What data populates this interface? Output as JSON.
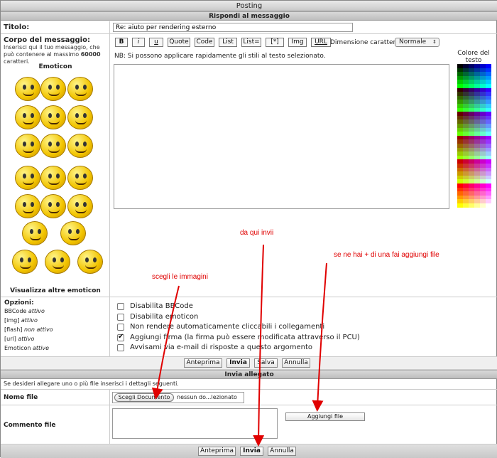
{
  "title": "Posting",
  "reply_section": "Rispondi al messaggio",
  "subject": {
    "label": "Titolo:",
    "value": "Re: aiuto per rendering esterno"
  },
  "body": {
    "label": "Corpo del messaggio:",
    "hint_pre": "Inserisci qui il tuo messaggio, che può contenere al massimo ",
    "hint_num": "60000",
    "hint_post": " caratteri."
  },
  "emoticon_title": "Emoticon",
  "more_emoticons": "Visualizza altre emoticon",
  "toolbar": {
    "buttons": [
      "B",
      "i",
      "u",
      "Quote",
      "Code",
      "List",
      "List=",
      "[*]",
      "Img",
      "URL"
    ],
    "font_size_label": "Dimensione carattere:",
    "font_size_value": "Normale"
  },
  "note": "NB: Si possono applicare rapidamente gli stili al testo selezionato.",
  "color_label": "Colore del testo",
  "options": {
    "label": "Opzioni:",
    "status": [
      {
        "name": "BBCode",
        "state": "attivo"
      },
      {
        "name": "[img]",
        "state": "attivo"
      },
      {
        "name": "[flash]",
        "state": "non attivo"
      },
      {
        "name": "[url]",
        "state": "attivo"
      },
      {
        "name": "Emoticon",
        "state": "attive"
      }
    ],
    "checkboxes": [
      {
        "label": "Disabilita BBCode",
        "checked": false
      },
      {
        "label": "Disabilita emoticon",
        "checked": false
      },
      {
        "label": "Non rendere automaticamente cliccabili i collegamenti",
        "checked": false
      },
      {
        "label": "Aggiungi firma (la firma può essere modificata attraverso il PCU)",
        "checked": true
      },
      {
        "label": "Avvisami via e-mail di risposte a questo argomento",
        "checked": false
      }
    ]
  },
  "actions": {
    "preview": "Anteprima",
    "send": "Invia",
    "save": "Salva",
    "cancel": "Annulla"
  },
  "attach": {
    "section": "Invia allegato",
    "hint": "Se desideri allegare uno o più file inserisci i dettagli seguenti.",
    "file_label": "Nome file",
    "choose_btn": "Scegli Documento",
    "no_file": "nessun do...lezionato",
    "comment_label": "Commento file",
    "add_file": "Aggiungi file"
  },
  "bottom_actions": {
    "preview": "Anteprima",
    "send": "Invia",
    "cancel": "Annulla"
  },
  "annotations": {
    "choose_images": "scegli le immagini",
    "send_here": "da qui invii",
    "add_more": "se ne hai + di una fai aggiungi file"
  }
}
